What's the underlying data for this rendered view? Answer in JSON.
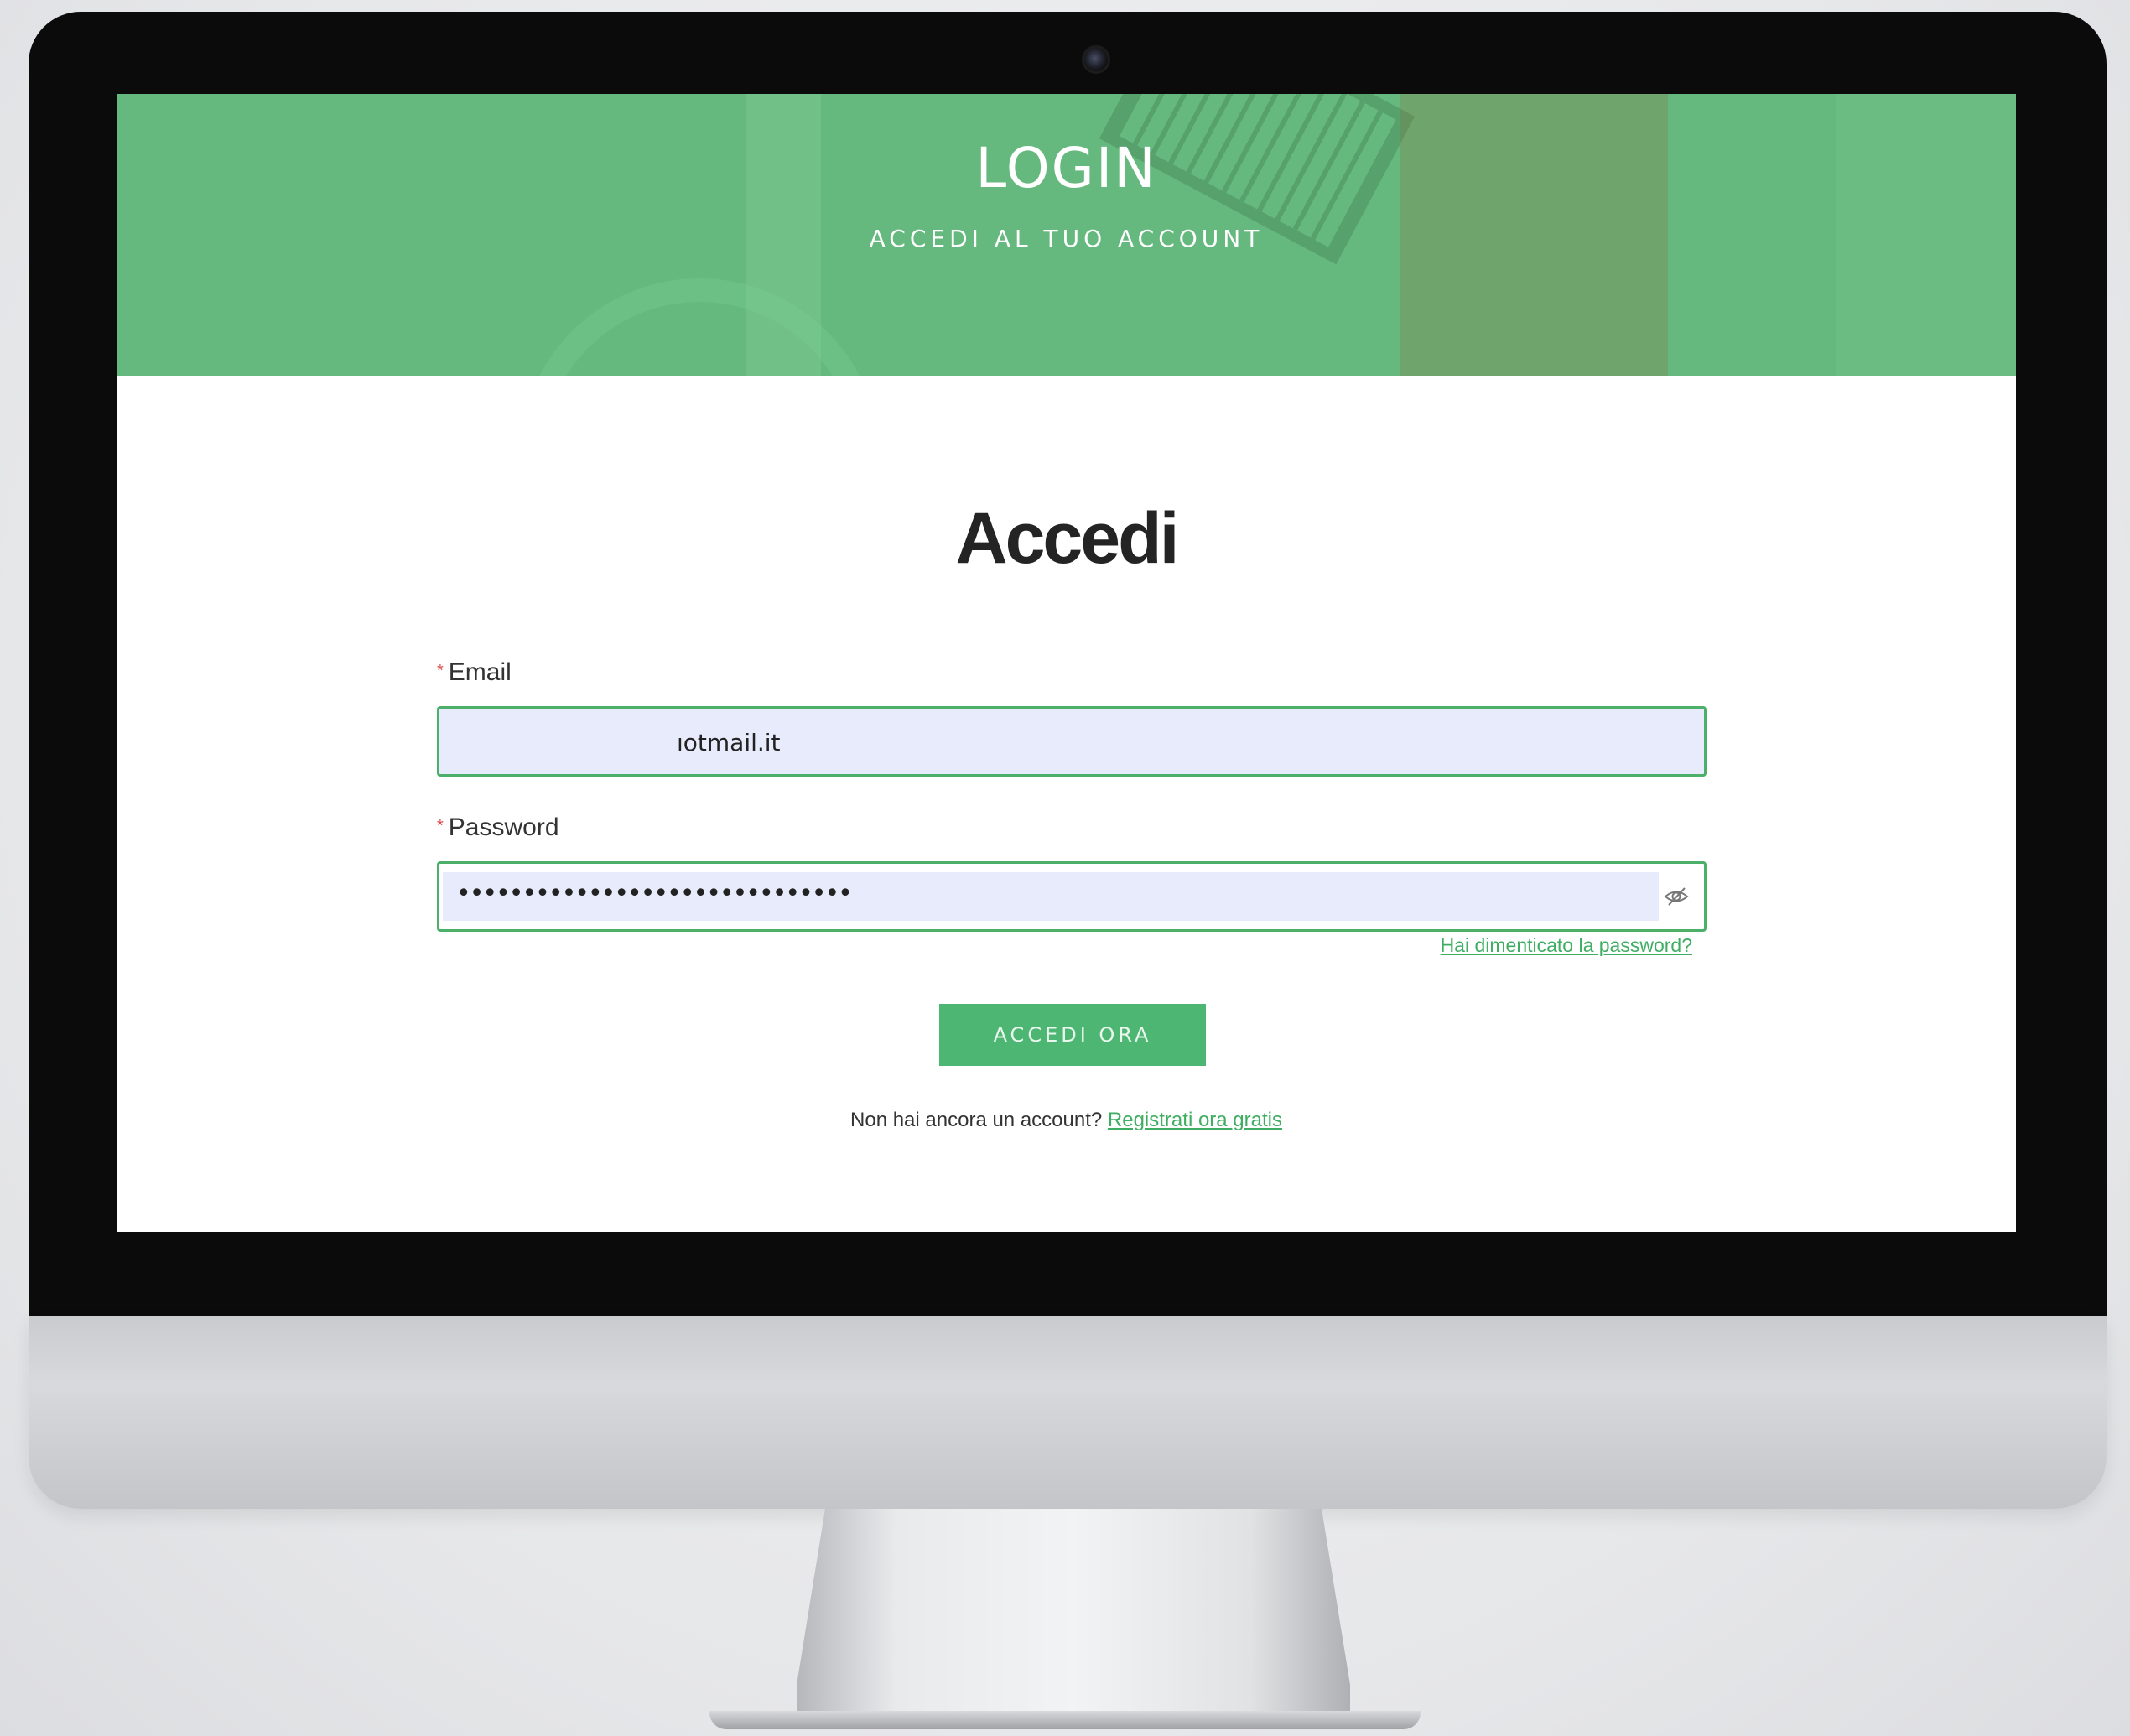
{
  "hero": {
    "title": "LOGIN",
    "subtitle": "ACCEDI AL TUO ACCOUNT"
  },
  "form": {
    "heading": "Accedi",
    "email": {
      "label": "Email",
      "required_mark": "*",
      "value": "ıotmail.it"
    },
    "password": {
      "label": "Password",
      "required_mark": "*",
      "value": "••••••••••••••••••••••••••••••"
    },
    "forgot_link": "Hai dimenticato la password?",
    "submit_label": "ACCEDI ORA",
    "signup_prompt": "Non hai ancora un account?",
    "signup_link": "Registrati ora gratis"
  },
  "colors": {
    "accent": "#4cb672",
    "hero_bg": "#66b97e",
    "required": "#e24a4a",
    "field_bg": "#e8ebfb"
  }
}
